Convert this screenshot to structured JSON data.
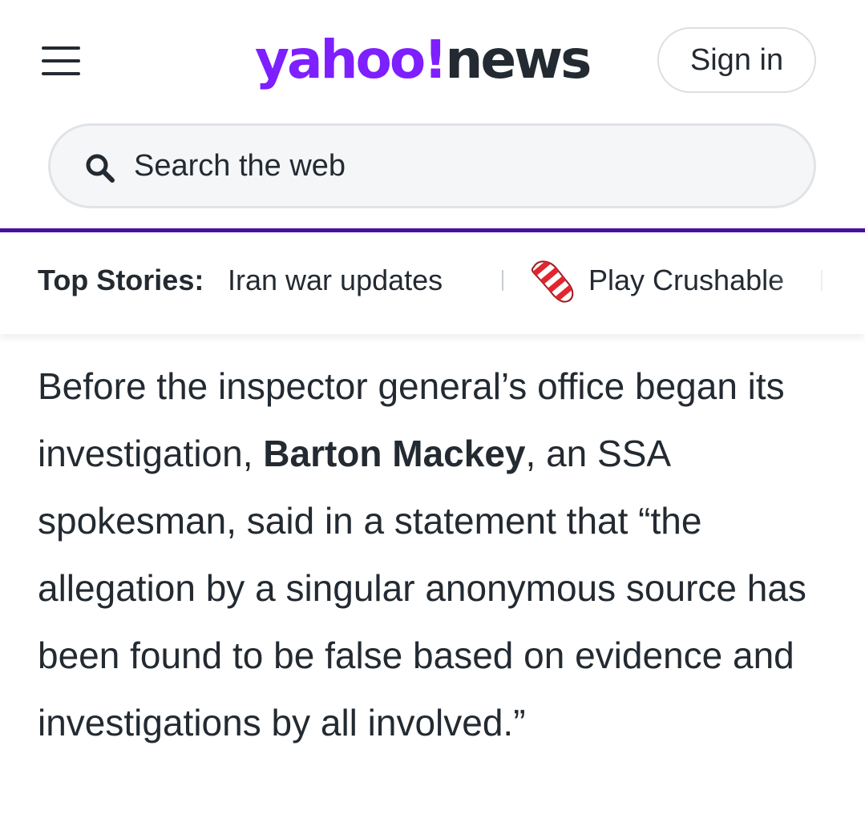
{
  "header": {
    "logo_primary": "yahoo!",
    "logo_secondary": "news",
    "signin_label": "Sign in",
    "brand_color": "#7e1fff",
    "accent_bar_color": "#4a0f9e"
  },
  "search": {
    "placeholder": "Search the web",
    "icon": "search-icon"
  },
  "top_stories": {
    "label": "Top Stories:",
    "items": [
      {
        "label": "Iran war updates"
      },
      {
        "label": "Play Crushable",
        "icon": "candy-icon"
      }
    ]
  },
  "article": {
    "text_before": "Before the inspector general’s office began its investigation, ",
    "bold_name": "Barton Mackey",
    "text_after": ", an SSA spokesman, said in a statement that “the allegation by a singular anonymous source has been found to be false based on evidence and investigations by all involved.”"
  }
}
